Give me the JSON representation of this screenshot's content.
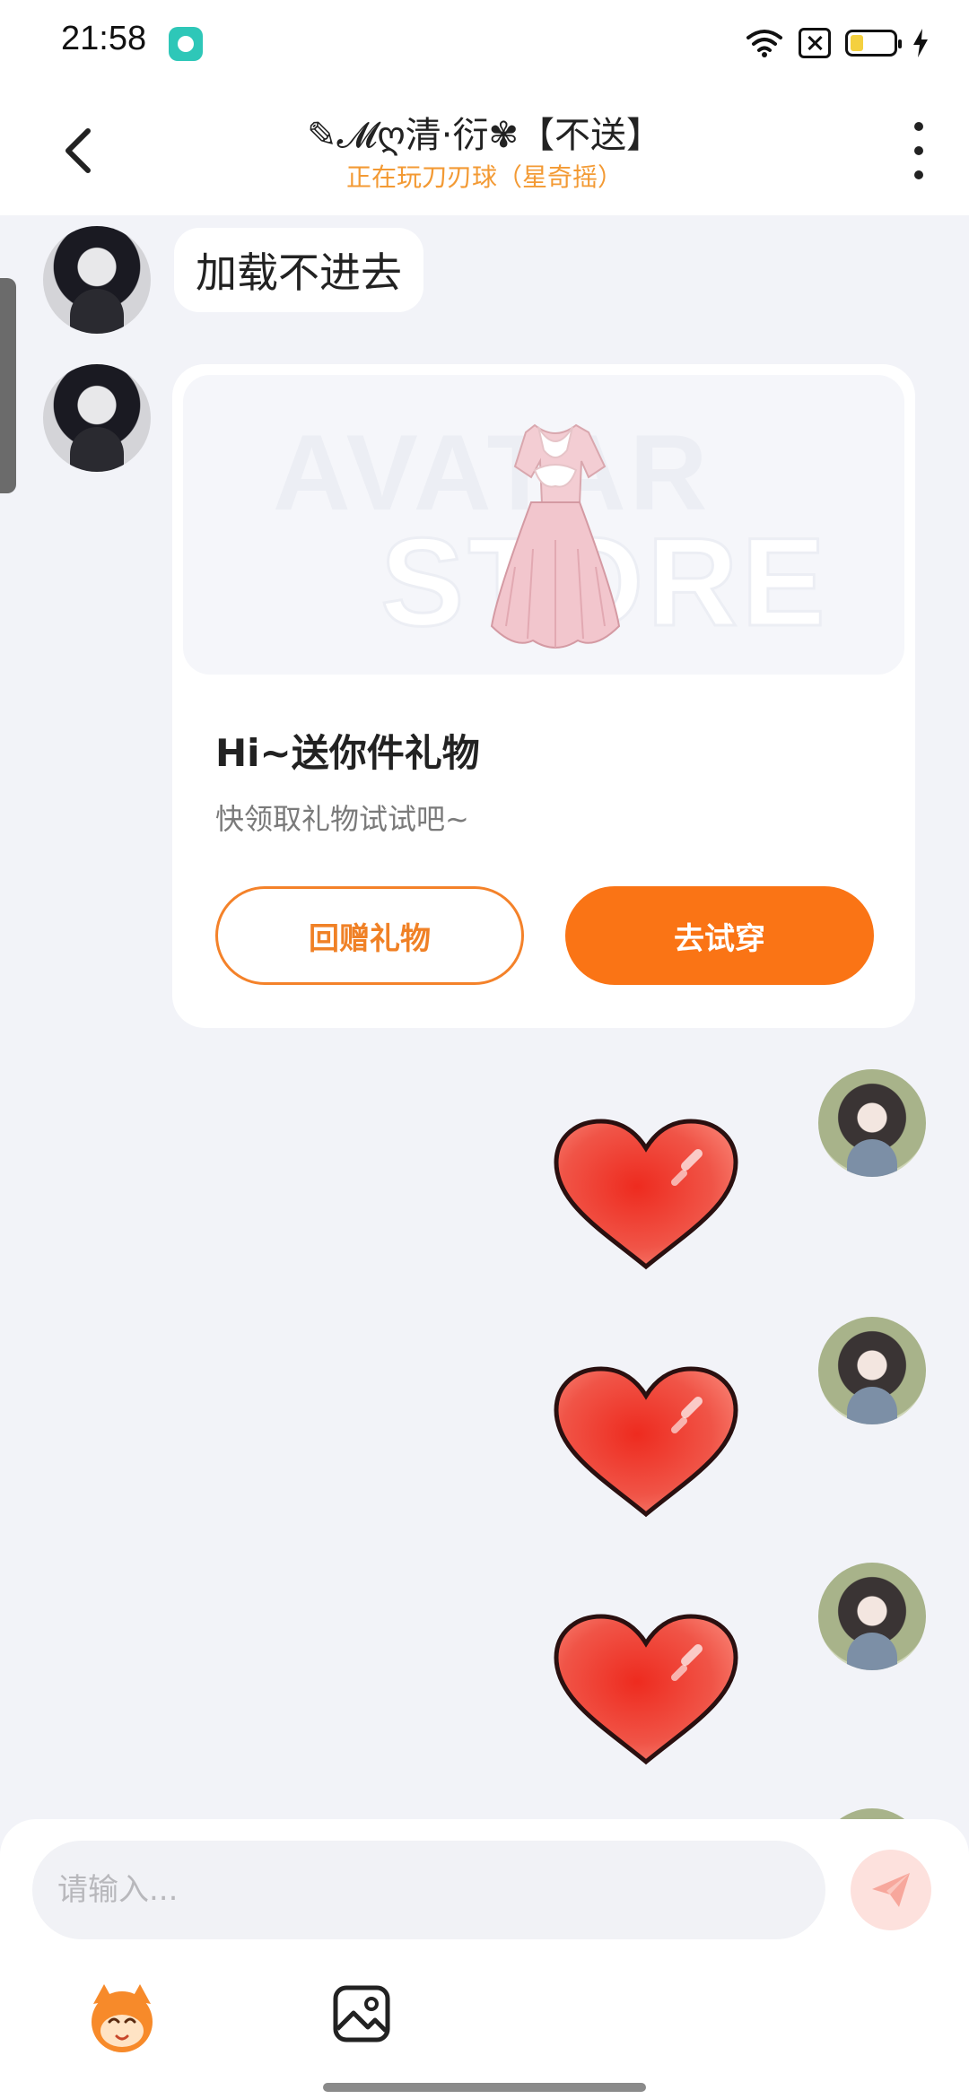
{
  "status_bar": {
    "time": "21:58",
    "icons": [
      "app-notification-icon",
      "wifi-icon",
      "sim-icon",
      "battery-icon",
      "charging-icon"
    ]
  },
  "header": {
    "title": "✎𝓜ღ清·衍✾【不送】",
    "subtitle": "正在玩刀刃球（星奇摇）",
    "back_icon": "chevron-left-icon",
    "more_icon": "more-vertical-icon"
  },
  "messages": [
    {
      "side": "left",
      "type": "text",
      "text": "加载不进去"
    },
    {
      "side": "left",
      "type": "gift",
      "image_watermark": [
        "AVATAR",
        "STORE"
      ],
      "title": "Hi~送你件礼物",
      "description": "快领取礼物试试吧~",
      "return_button": "回赠礼物",
      "try_button": "去试穿"
    },
    {
      "side": "right",
      "type": "sticker",
      "sticker": "heart-icon"
    },
    {
      "side": "right",
      "type": "sticker",
      "sticker": "heart-icon"
    },
    {
      "side": "right",
      "type": "sticker",
      "sticker": "heart-icon"
    }
  ],
  "input": {
    "placeholder": "请输入...",
    "send_icon": "send-icon",
    "tools": [
      "mascot-icon",
      "image-icon"
    ]
  },
  "colors": {
    "accent": "#fa7415",
    "subtitle": "#f39a34",
    "background": "#f2f3f8"
  }
}
